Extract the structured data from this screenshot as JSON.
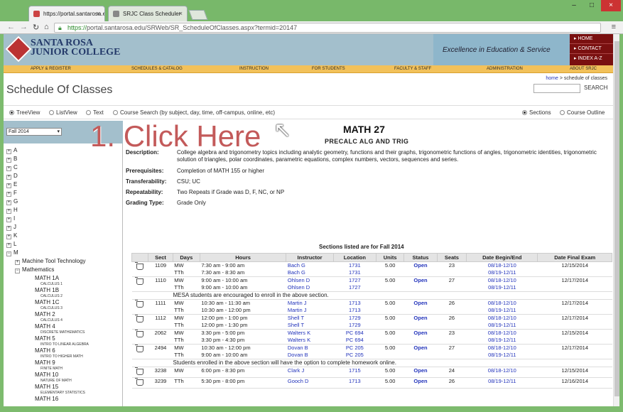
{
  "browser": {
    "tabs": [
      {
        "label": "https://portal.santarosa.e",
        "active": true
      },
      {
        "label": "SRJC Class Scheduler",
        "active": false
      }
    ],
    "url_scheme": "https://",
    "url_rest": "portal.santarosa.edu/SRWeb/SR_ScheduleOfClasses.aspx?termid=20147"
  },
  "site": {
    "logo_line1": "SANTA ROSA",
    "logo_line2": "JUNIOR COLLEGE",
    "tagline": "Excellence in Education & Service",
    "quick_links": [
      "HOME",
      "CONTACT",
      "INDEX A-Z"
    ],
    "nav": [
      "APPLY & REGISTER",
      "SCHEDULES & CATALOG",
      "INSTRUCTION",
      "FOR STUDENTS",
      "FACULTY & STAFF",
      "ADMINISTRATION",
      "ABOUT SRJC"
    ],
    "crumb_home": "home",
    "crumb_sep": ">",
    "crumb_current": "schedule of classes",
    "page_title": "Schedule Of Classes",
    "search_button": "SEARCH"
  },
  "views": {
    "left": [
      "TreeView",
      "ListView",
      "Text",
      "Course Search (by subject, day, time, off-campus, online, etc)"
    ],
    "right": [
      "Sections",
      "Course Outline"
    ]
  },
  "sidebar": {
    "term": "Fall 2014",
    "letters": [
      "A",
      "B",
      "C",
      "D",
      "E",
      "F",
      "G",
      "H",
      "I",
      "J",
      "K",
      "L",
      "M"
    ],
    "subjects": [
      "Machine Tool Technology",
      "Mathematics"
    ],
    "courses": [
      {
        "code": "MATH 1A",
        "name": "CALCULUS 1"
      },
      {
        "code": "MATH 1B",
        "name": "CALCULUS 2"
      },
      {
        "code": "MATH 1C",
        "name": "CALCULUS 3"
      },
      {
        "code": "MATH 2",
        "name": "CALCULUS 4"
      },
      {
        "code": "MATH 4",
        "name": "DISCRETE MATHEMATICS"
      },
      {
        "code": "MATH 5",
        "name": "INTRO TO LINEAR ALGEBRA"
      },
      {
        "code": "MATH 6",
        "name": "INTRO TO HIGHER MATH"
      },
      {
        "code": "MATH 9",
        "name": "FINITE MATH"
      },
      {
        "code": "MATH 10",
        "name": "NATURE OF MATH"
      },
      {
        "code": "MATH 15",
        "name": "ELEMENTARY STATISTICS"
      },
      {
        "code": "MATH 16",
        "name": ""
      }
    ]
  },
  "overlay": {
    "instruction": "1. Click Here"
  },
  "course": {
    "code": "MATH 27",
    "title": "PRECALC ALG AND TRIG",
    "fields": [
      {
        "label": "Description:",
        "value": "College algebra and trigonometry topics including analytic geometry, functions and their graphs, trigonometric functions of angles, trigonometric identities, trigonometric solution of triangles, polar coordinates, parametric equations, complex numbers, vectors, sequences and series."
      },
      {
        "label": "Prerequisites:",
        "value": "Completion of MATH 155 or higher"
      },
      {
        "label": "Transferability:",
        "value": "CSU; UC"
      },
      {
        "label": "Repeatability:",
        "value": "Two Repeats if Grade was D, F, NC, or NP"
      },
      {
        "label": "Grading Type:",
        "value": "Grade Only"
      }
    ],
    "sections_caption": "Sections listed are for Fall 2014",
    "columns": [
      "",
      "Sect",
      "Days",
      "Hours",
      "Instructor",
      "Location",
      "Units",
      "Status",
      "Seats",
      "Date Begin/End",
      "Date Final Exam"
    ],
    "rows": [
      {
        "type": "sec",
        "sect": "1109",
        "days": [
          "MW",
          "TTh"
        ],
        "hours": [
          "7:30 am - 9:00 am",
          "7:30 am - 8:30 am"
        ],
        "instr": [
          "Bach G",
          "Bach G"
        ],
        "loc": [
          "1731",
          "1731"
        ],
        "units": "5.00",
        "status": "Open",
        "seats": "23",
        "dates": [
          "08/18-12/10",
          "08/19-12/11"
        ],
        "exam": "12/15/2014"
      },
      {
        "type": "sec",
        "sect": "1110",
        "days": [
          "MW",
          "TTh"
        ],
        "hours": [
          "9:00 am - 10:00 am",
          "9:00 am - 10:00 am"
        ],
        "instr": [
          "Ohlsen D",
          "Ohlsen D"
        ],
        "loc": [
          "1727",
          "1727"
        ],
        "units": "5.00",
        "status": "Open",
        "seats": "27",
        "dates": [
          "08/18-12/10",
          "08/19-12/11"
        ],
        "exam": "12/17/2014"
      },
      {
        "type": "note",
        "text": "MESA students are encouraged to enroll in the above section."
      },
      {
        "type": "sec",
        "sect": "1111",
        "days": [
          "MW",
          "TTh"
        ],
        "hours": [
          "10:30 am - 11:30 am",
          "10:30 am - 12:00 pm"
        ],
        "instr": [
          "Martin J",
          "Martin J"
        ],
        "loc": [
          "1713",
          "1713"
        ],
        "units": "5.00",
        "status": "Open",
        "seats": "26",
        "dates": [
          "08/18-12/10",
          "08/19-12/11"
        ],
        "exam": "12/17/2014"
      },
      {
        "type": "sec",
        "sect": "1112",
        "days": [
          "MW",
          "TTh"
        ],
        "hours": [
          "12:00 pm - 1:00 pm",
          "12:00 pm - 1:30 pm"
        ],
        "instr": [
          "Shell T",
          "Shell T"
        ],
        "loc": [
          "1729",
          "1729"
        ],
        "units": "5.00",
        "status": "Open",
        "seats": "26",
        "dates": [
          "08/18-12/10",
          "08/19-12/11"
        ],
        "exam": "12/17/2014"
      },
      {
        "type": "sec",
        "sect": "2062",
        "days": [
          "MW",
          "TTh"
        ],
        "hours": [
          "3:30 pm - 5:00 pm",
          "3:30 pm - 4:30 pm"
        ],
        "instr": [
          "Walters K",
          "Walters K"
        ],
        "loc": [
          "PC 694",
          "PC 694"
        ],
        "units": "5.00",
        "status": "Open",
        "seats": "23",
        "dates": [
          "08/18-12/10",
          "08/19-12/11"
        ],
        "exam": "12/15/2014"
      },
      {
        "type": "sec",
        "sect": "2494",
        "days": [
          "MW",
          "TTh"
        ],
        "hours": [
          "10:30 am - 12:00 pm",
          "9:00 am - 10:00 am"
        ],
        "instr": [
          "Dovan B",
          "Dovan B"
        ],
        "loc": [
          "PC 205",
          "PC 205"
        ],
        "units": "5.00",
        "status": "Open",
        "seats": "27",
        "dates": [
          "08/18-12/10",
          "08/19-12/11"
        ],
        "exam": "12/17/2014"
      },
      {
        "type": "note",
        "text": "Students enrolled in the above section will have the option to complete homework online."
      },
      {
        "type": "sec",
        "sect": "3238",
        "days": [
          "MW"
        ],
        "hours": [
          "6:00 pm - 8:30 pm"
        ],
        "instr": [
          "Clark J"
        ],
        "loc": [
          "1715"
        ],
        "units": "5.00",
        "status": "Open",
        "seats": "24",
        "dates": [
          "08/18-12/10"
        ],
        "exam": "12/15/2014"
      },
      {
        "type": "sec",
        "sect": "3239",
        "days": [
          "TTh"
        ],
        "hours": [
          "5:30 pm - 8:00 pm"
        ],
        "instr": [
          "Gooch D"
        ],
        "loc": [
          "1713"
        ],
        "units": "5.00",
        "status": "Open",
        "seats": "26",
        "dates": [
          "08/19-12/11"
        ],
        "exam": "12/16/2014"
      }
    ]
  },
  "colors": {
    "accent_link": "#2233bb",
    "header_band": "#a3bfcc",
    "nav_gold": "#f2c15a",
    "quick_links_red": "#7a1010",
    "overlay_text": "#c35a5a"
  }
}
